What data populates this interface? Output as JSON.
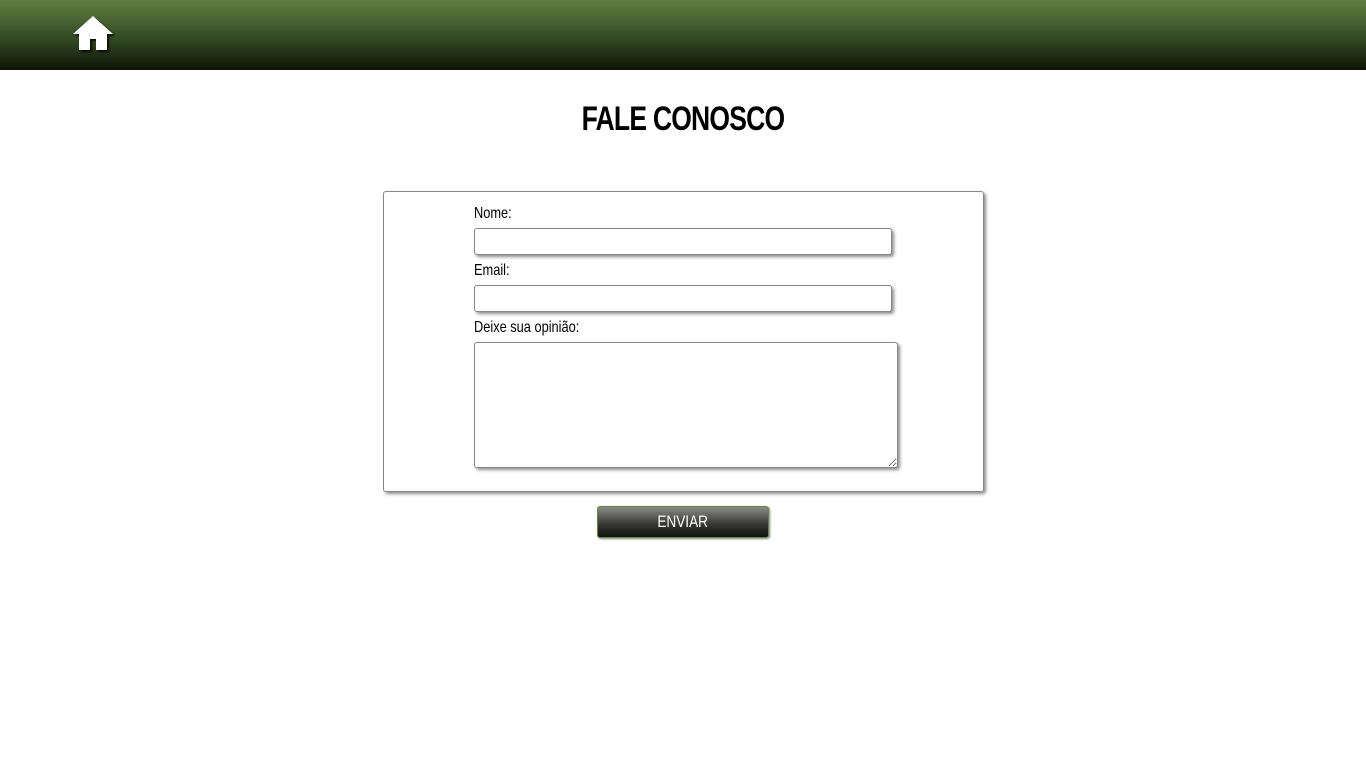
{
  "header": {
    "home_icon": "home-icon"
  },
  "page": {
    "title": "FALE CONOSCO"
  },
  "form": {
    "name_label": "Nome:",
    "name_value": "",
    "email_label": "Email:",
    "email_value": "",
    "opinion_label": "Deixe sua opinião:",
    "opinion_value": "",
    "submit_label": "ENVIAR"
  },
  "colors": {
    "header_top": "#5f8142",
    "header_bottom": "#0b1405",
    "button_border": "#5f8a3a"
  }
}
